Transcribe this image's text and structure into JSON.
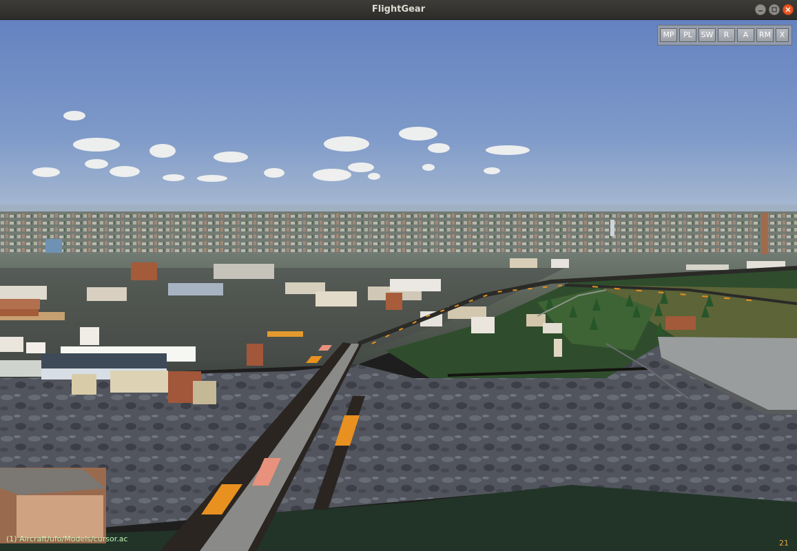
{
  "window": {
    "title": "FlightGear",
    "controls": [
      "minimize-icon",
      "maximize-icon",
      "close-icon"
    ],
    "close_color": "#e95420"
  },
  "hud": {
    "buttons": [
      {
        "id": "mp",
        "label": "MP"
      },
      {
        "id": "pl",
        "label": "PL"
      },
      {
        "id": "sw",
        "label": "SW"
      },
      {
        "id": "r",
        "label": "R"
      },
      {
        "id": "a",
        "label": "A"
      },
      {
        "id": "rm",
        "label": "RM"
      },
      {
        "id": "x",
        "label": "X"
      }
    ]
  },
  "status": {
    "model_path": "(1)  Aircraft/ufo/Models/cursor.ac",
    "frame_rate": "21"
  },
  "scene": {
    "description_icon": "3d-terrain-view",
    "sky_color": "#6f8fc4",
    "horizon_color": "#a6b7cf"
  }
}
